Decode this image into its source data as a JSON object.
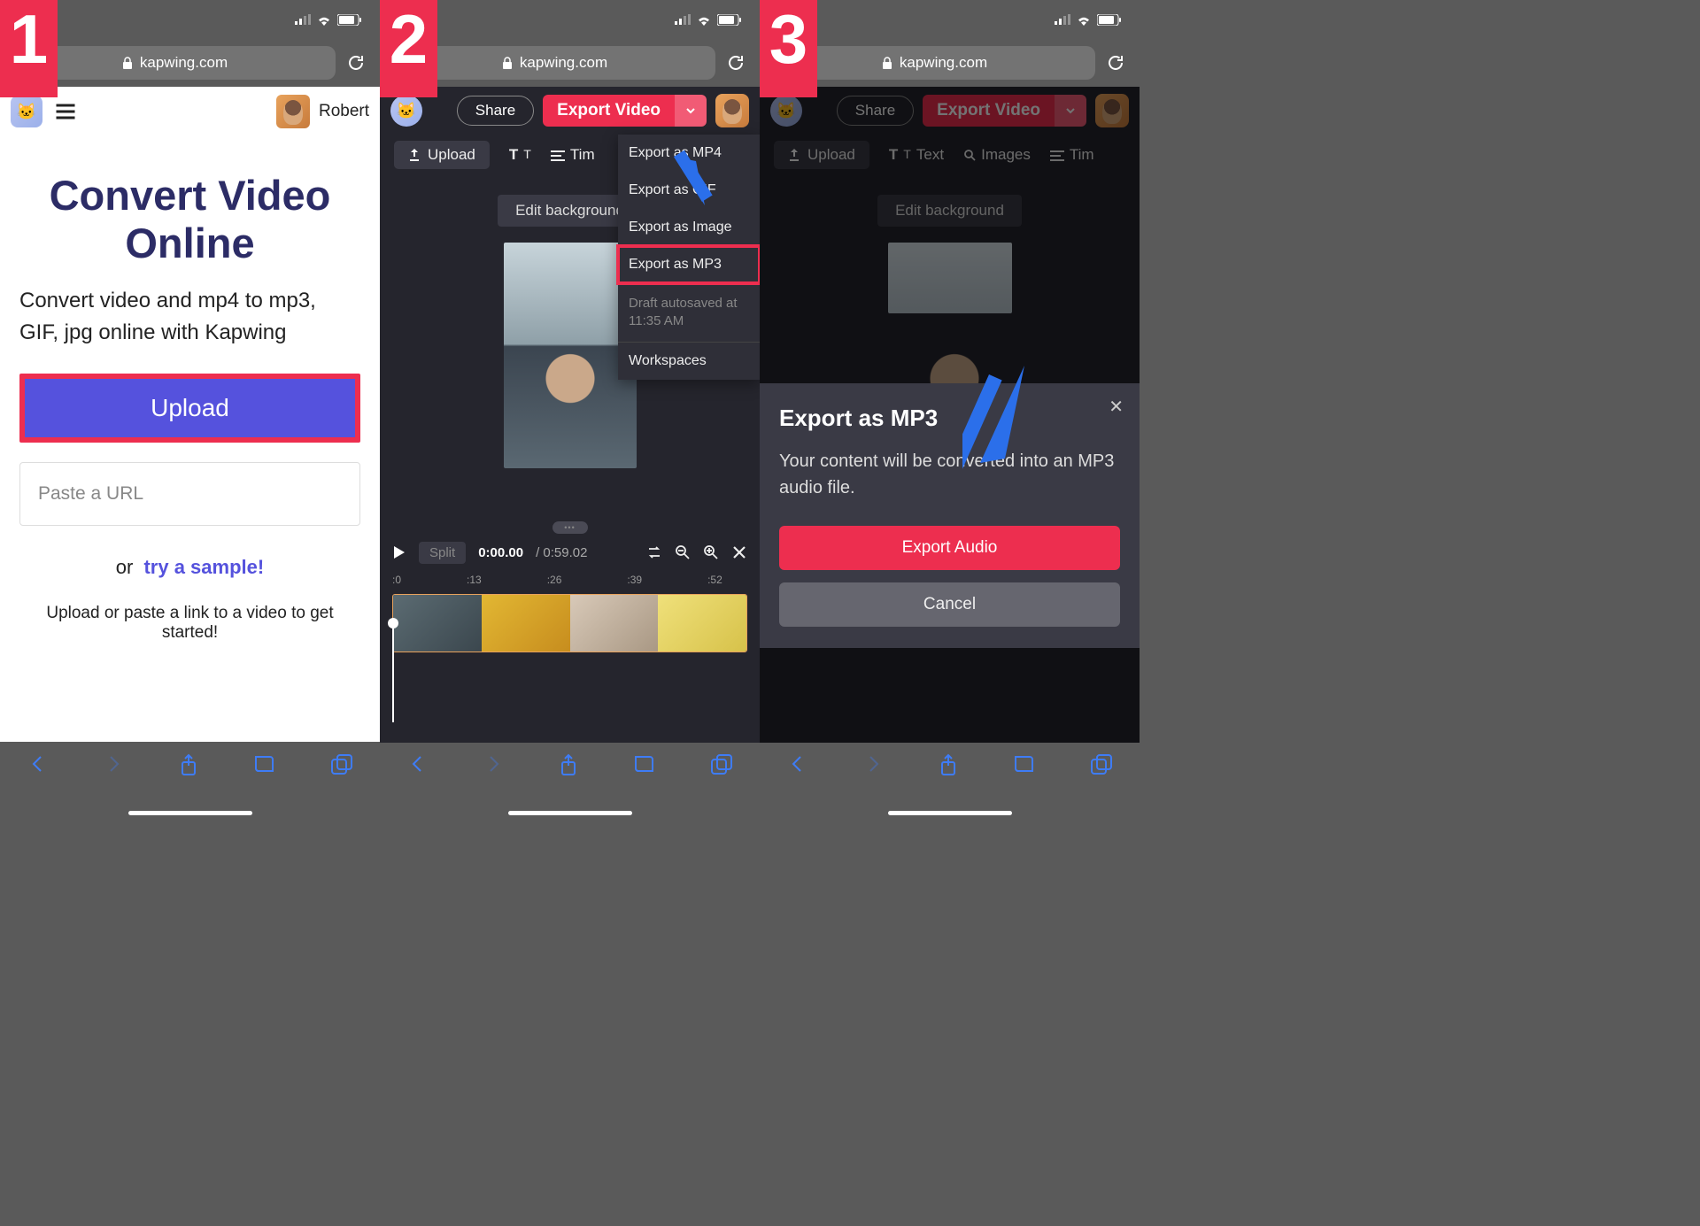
{
  "address_bar": {
    "domain": "kapwing.com"
  },
  "steps": [
    "1",
    "2",
    "3"
  ],
  "panel1": {
    "user_name": "Robert",
    "title": "Convert Video Online",
    "subtitle": "Convert video and mp4 to mp3, GIF, jpg online with Kapwing",
    "upload_label": "Upload",
    "url_placeholder": "Paste a URL",
    "or_label": "or",
    "try_sample_label": "try a sample!",
    "footer_text": "Upload or paste a link to a video to get started!"
  },
  "editor": {
    "share_label": "Share",
    "export_label": "Export Video",
    "toolbar": {
      "upload": "Upload",
      "text": "Text",
      "images": "Images",
      "timeline": "Tim"
    },
    "edit_background_label": "Edit background",
    "dropdown": {
      "items": [
        "Export as MP4",
        "Export as GIF",
        "Export as Image",
        "Export as MP3"
      ],
      "autosave": "Draft autosaved at 11:35 AM",
      "workspaces": "Workspaces"
    },
    "timeline": {
      "split_label": "Split",
      "current_time": "0:00.00",
      "duration": "0:59.02",
      "ruler": [
        ":0",
        ":13",
        ":26",
        ":39",
        ":52"
      ]
    }
  },
  "modal": {
    "title": "Export as MP3",
    "body": "Your content will be converted into an MP3 audio file.",
    "primary_label": "Export Audio",
    "cancel_label": "Cancel"
  }
}
